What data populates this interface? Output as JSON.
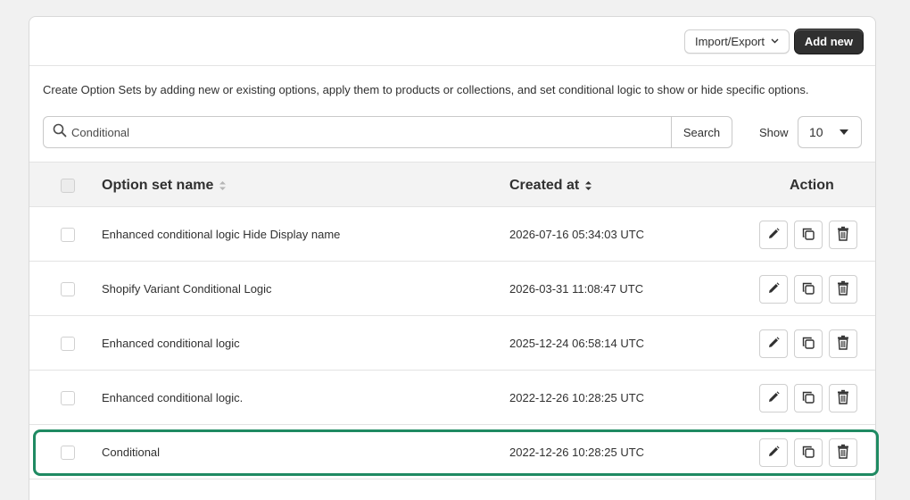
{
  "toolbar": {
    "import_export_label": "Import/Export",
    "add_new_label": "Add new"
  },
  "description": "Create Option Sets by adding new or existing options, apply them to products or collections, and set conditional logic to show or hide specific options.",
  "search": {
    "value": "Conditional",
    "button_label": "Search"
  },
  "pagination": {
    "show_label": "Show",
    "page_size": "10"
  },
  "table": {
    "headers": {
      "name": "Option set name",
      "created": "Created at",
      "action": "Action"
    },
    "rows": [
      {
        "name": "Enhanced conditional logic Hide Display name",
        "created": "2026-07-16 05:34:03 UTC"
      },
      {
        "name": "Shopify Variant Conditional Logic",
        "created": "2026-03-31 11:08:47 UTC"
      },
      {
        "name": "Enhanced conditional logic",
        "created": "2025-12-24 06:58:14 UTC"
      },
      {
        "name": "Enhanced conditional logic.",
        "created": "2022-12-26 10:28:25 UTC"
      },
      {
        "name": "Conditional",
        "created": "2022-12-26 10:28:25 UTC"
      }
    ]
  },
  "colors": {
    "primary_button": "#303030",
    "highlight": "#1f8a62",
    "background": "#f1f1f1"
  },
  "icons": [
    "search-icon",
    "chevron-down-icon",
    "sort-icon",
    "edit-icon",
    "duplicate-icon",
    "delete-icon"
  ]
}
